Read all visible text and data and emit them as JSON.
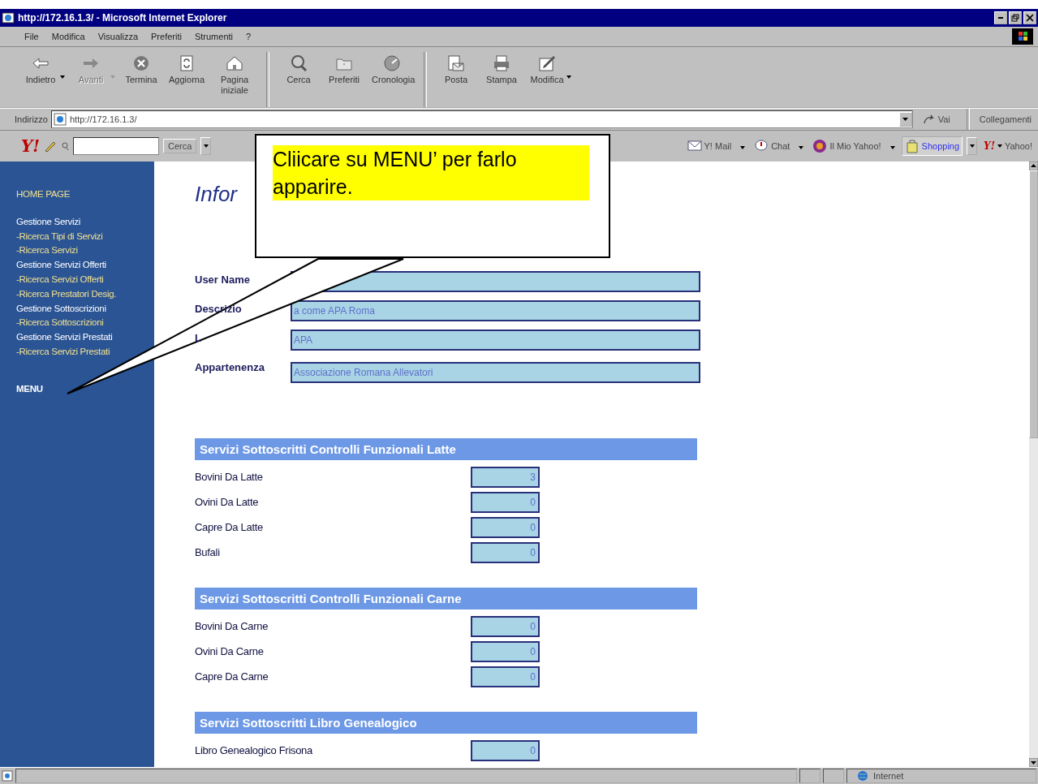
{
  "window": {
    "title": "http://172.16.1.3/ - Microsoft Internet Explorer"
  },
  "menu": [
    "File",
    "Modifica",
    "Visualizza",
    "Preferiti",
    "Strumenti",
    "?"
  ],
  "toolbar": [
    {
      "kind": "back",
      "label": "Indietro",
      "disabled": false,
      "dropdown": true
    },
    {
      "kind": "forward",
      "label": "Avanti",
      "disabled": true,
      "dropdown": true
    },
    {
      "kind": "stop",
      "label": "Termina",
      "disabled": false,
      "dropdown": false
    },
    {
      "kind": "refresh",
      "label": "Aggiorna",
      "disabled": false,
      "dropdown": false
    },
    {
      "kind": "home",
      "label": "Pagina iniziale",
      "disabled": false,
      "dropdown": false
    },
    {
      "kind": "search",
      "label": "Cerca",
      "disabled": false,
      "dropdown": false,
      "sep": true
    },
    {
      "kind": "favorites",
      "label": "Preferiti",
      "disabled": false,
      "dropdown": false
    },
    {
      "kind": "history",
      "label": "Cronologia",
      "disabled": false,
      "dropdown": false
    },
    {
      "kind": "mail",
      "label": "Posta",
      "disabled": false,
      "dropdown": false,
      "sep": true
    },
    {
      "kind": "print",
      "label": "Stampa",
      "disabled": false,
      "dropdown": false
    },
    {
      "kind": "edit",
      "label": "Modifica",
      "disabled": false,
      "dropdown": true
    }
  ],
  "address": {
    "label": "Indirizzo",
    "value": "http://172.16.1.3/",
    "go": "Vai",
    "links": "Collegamenti"
  },
  "yahoo_bar": {
    "logo": "Y!",
    "search_button": "Cerca",
    "items": [
      {
        "kind": "mail",
        "label": "Y! Mail"
      },
      {
        "kind": "chat",
        "label": "Chat"
      },
      {
        "kind": "myyahoo",
        "label": "Il Mio Yahoo!"
      },
      {
        "kind": "shopping",
        "label": "Shopping"
      }
    ],
    "end_logo": "Y!",
    "end_label": "Yahoo!"
  },
  "sidebar": {
    "items": [
      {
        "kind": "home",
        "label": "HOME PAGE"
      },
      {
        "kind": "heading",
        "label": "Gestione Servizi"
      },
      {
        "kind": "link",
        "label": "-Ricerca Tipi di Servizi"
      },
      {
        "kind": "link",
        "label": "-Ricerca Servizi"
      },
      {
        "kind": "heading",
        "label": "Gestione Servizi Offerti"
      },
      {
        "kind": "link",
        "label": "-Ricerca Servizi Offerti"
      },
      {
        "kind": "link",
        "label": "-Ricerca Prestatori Desig."
      },
      {
        "kind": "heading",
        "label": "Gestione Sottoscrizioni"
      },
      {
        "kind": "link",
        "label": "-Ricerca Sottoscrizioni"
      },
      {
        "kind": "heading",
        "label": "Gestione Servizi Prestati"
      },
      {
        "kind": "link",
        "label": "-Ricerca Servizi Prestati"
      }
    ],
    "menu": "MENU"
  },
  "page": {
    "heading": "Infor",
    "fields": [
      {
        "label": "User Name"
      },
      {
        "label": "Descrizio",
        "value": "a come APA Roma"
      },
      {
        "label": "L",
        "value": "APA"
      },
      {
        "label": "Appartenenza",
        "value": "Associazione Romana Allevatori"
      }
    ],
    "sections": [
      {
        "title": "Servizi Sottoscritti Controlli Funzionali Latte",
        "rows": [
          {
            "label": "Bovini Da Latte",
            "value": "3"
          },
          {
            "label": "Ovini Da Latte",
            "value": "0"
          },
          {
            "label": "Capre Da Latte",
            "value": "0"
          },
          {
            "label": "Bufali",
            "value": "0"
          }
        ]
      },
      {
        "title": "Servizi Sottoscritti Controlli Funzionali Carne",
        "rows": [
          {
            "label": "Bovini Da Carne",
            "value": "0"
          },
          {
            "label": "Ovini Da Carne",
            "value": "0"
          },
          {
            "label": "Capre Da Carne",
            "value": "0"
          }
        ]
      },
      {
        "title": "Servizi Sottoscritti Libro Genealogico",
        "rows": [
          {
            "label": "Libro Genealogico Frisona",
            "value": "0"
          }
        ]
      }
    ]
  },
  "callout": {
    "text": "Cliicare su MENU’ per farlo apparire."
  },
  "status_bar": {
    "zone": "Internet"
  }
}
